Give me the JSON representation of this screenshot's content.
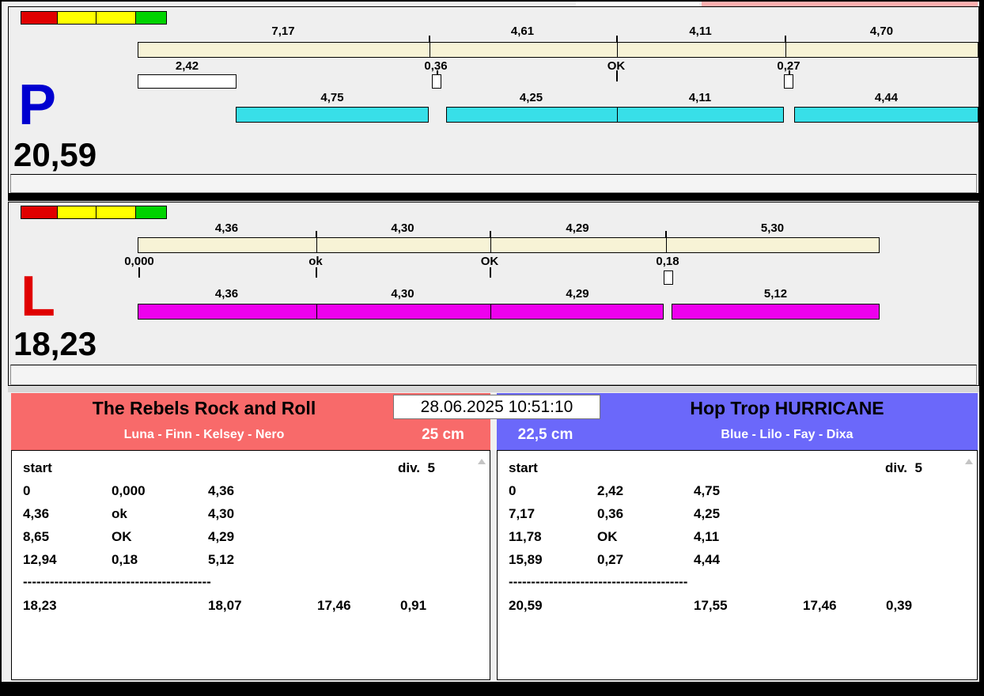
{
  "colors": {
    "pink": "#ffb0b0",
    "beige": "#f7f3d6",
    "cyan": "#38dfe8",
    "magenta": "#ee00ee",
    "seg_red": "#e00000",
    "seg_yellow": "#ffff00",
    "seg_green": "#00d300",
    "p_letter": "#0000d0",
    "l_letter": "#e00000",
    "left_header": "#f86a6a",
    "right_header": "#6b68fa"
  },
  "datetime": "28.06.2025 10:51:10",
  "p_panel": {
    "letter": "P",
    "total": "20,59",
    "top_values": [
      "7,17",
      "4,61",
      "4,11",
      "4,70"
    ],
    "mid_values": [
      "2,42",
      "0,36",
      "OK",
      "0,27"
    ],
    "bar_values": [
      "4,75",
      "4,25",
      "4,11",
      "4,44"
    ]
  },
  "l_panel": {
    "letter": "L",
    "total": "18,23",
    "top_values": [
      "4,36",
      "4,30",
      "4,29",
      "5,30"
    ],
    "mid_values": [
      "0,000",
      "ok",
      "OK",
      "0,18"
    ],
    "bar_values": [
      "4,36",
      "4,30",
      "4,29",
      "5,12"
    ]
  },
  "left_team": {
    "name": "The Rebels Rock and Roll",
    "members": "Luna - Finn - Kelsey - Nero",
    "height_class": "25 cm",
    "start_label": "start",
    "div_label": "div.  5",
    "rows": [
      [
        "0",
        "0,000",
        "4,36"
      ],
      [
        "4,36",
        "ok",
        "4,30"
      ],
      [
        "8,65",
        "OK",
        "4,29"
      ],
      [
        "12,94",
        "0,18",
        "5,12"
      ]
    ],
    "divider": "------------------------------------------",
    "totals": [
      "18,23",
      "18,07",
      "17,46",
      "0,91"
    ]
  },
  "right_team": {
    "name": "Hop Trop HURRICANE",
    "members": "Blue - Lilo - Fay - Dixa",
    "height_class": "22,5 cm",
    "start_label": "start",
    "div_label": "div.  5",
    "rows": [
      [
        "0",
        "2,42",
        "4,75"
      ],
      [
        "7,17",
        "0,36",
        "4,25"
      ],
      [
        "11,78",
        "OK",
        "4,11"
      ],
      [
        "15,89",
        "0,27",
        "4,44"
      ]
    ],
    "divider": "----------------------------------------",
    "totals": [
      "20,59",
      "17,55",
      "17,46",
      "0,39"
    ]
  }
}
